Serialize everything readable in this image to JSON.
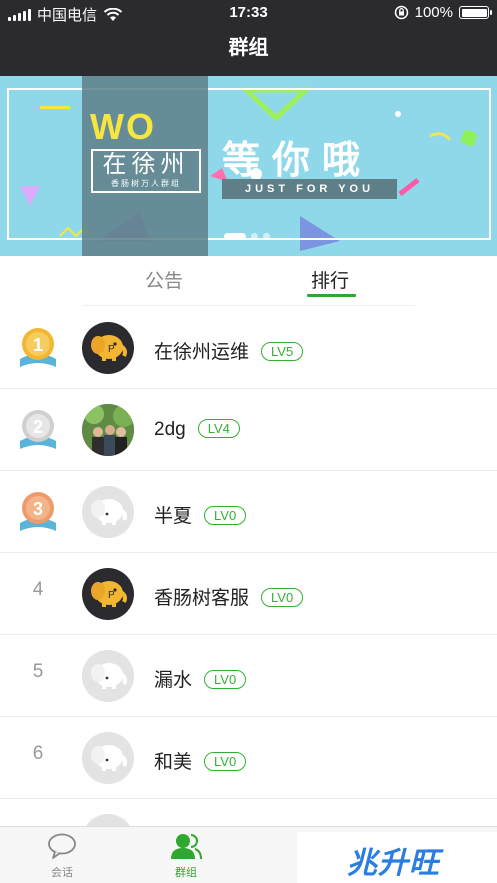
{
  "status_bar": {
    "carrier": "中国电信",
    "time": "17:33",
    "battery": "100%"
  },
  "nav": {
    "title": "群组"
  },
  "banner": {
    "wo": "WO",
    "city": "在徐州",
    "city_sub": "香肠树万人群组",
    "headline": "等你哦",
    "tagline": "JUST FOR YOU",
    "active_slide": 1
  },
  "tabs": [
    {
      "label": "公告",
      "active": false
    },
    {
      "label": "排行",
      "active": true
    }
  ],
  "ranking": [
    {
      "rank": "1",
      "medal_color": "#f2b632",
      "name": "在徐州运维",
      "level": "LV5",
      "avatar": "elephant-dark"
    },
    {
      "rank": "2",
      "medal_color": "#d8d8d8",
      "name": "2dg",
      "level": "LV4",
      "avatar": "photo"
    },
    {
      "rank": "3",
      "medal_color": "#ef9a6a",
      "name": "半夏",
      "level": "LV0",
      "avatar": "elephant-light"
    },
    {
      "rank": "4",
      "name": "香肠树客服",
      "level": "LV0",
      "avatar": "elephant-dark"
    },
    {
      "rank": "5",
      "name": "漏水",
      "level": "LV0",
      "avatar": "elephant-light"
    },
    {
      "rank": "6",
      "name": "和美",
      "level": "LV0",
      "avatar": "elephant-light"
    }
  ],
  "tabbar": [
    {
      "label": "会话",
      "icon": "chat-bubble-icon",
      "active": false
    },
    {
      "label": "群组",
      "icon": "group-icon",
      "active": true
    }
  ],
  "watermark": {
    "text": "兆升旺"
  },
  "colors": {
    "accent": "#2fa82f",
    "header": "#2b2a2f",
    "banner": "#8fd8ea"
  }
}
